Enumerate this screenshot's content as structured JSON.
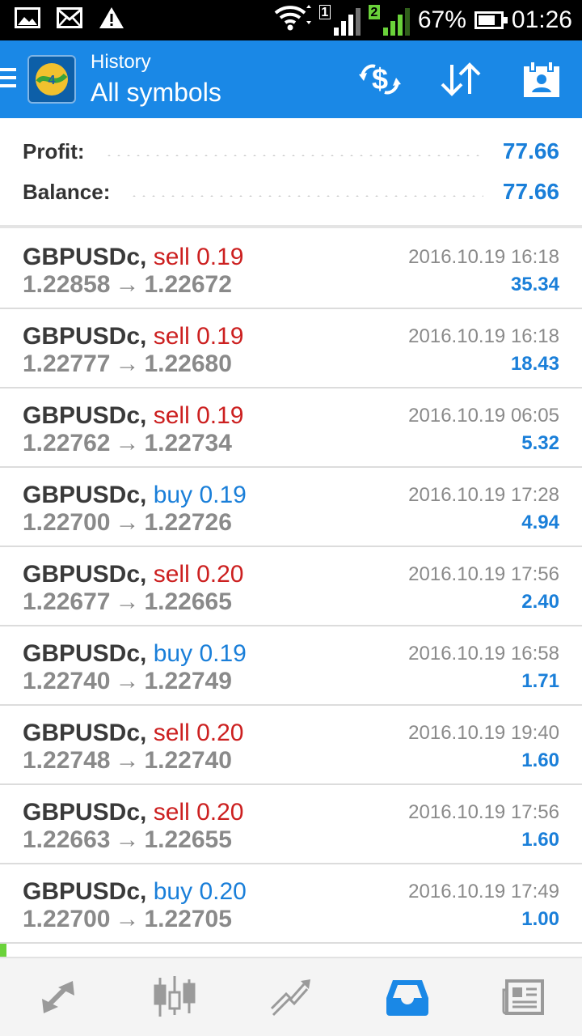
{
  "status_bar": {
    "icons_left": [
      "image-icon",
      "mail-icon",
      "warning-icon"
    ],
    "sim1_label": "1",
    "sim2_label": "2",
    "battery": "67%",
    "battery_level": 0.67,
    "time": "01:26"
  },
  "appbar": {
    "subtitle": "History",
    "title": "All symbols",
    "actions": [
      "currency-switch-icon",
      "sort-icon",
      "calendar-icon"
    ]
  },
  "summary": {
    "profit_label": "Profit:",
    "profit_value": "77.66",
    "balance_label": "Balance:",
    "balance_value": "77.66"
  },
  "deals": [
    {
      "symbol": "GBPUSDc,",
      "type": "sell",
      "volume": "0.19",
      "open": "1.22858",
      "close": "1.22672",
      "time": "2016.10.19 16:18",
      "profit": "35.34"
    },
    {
      "symbol": "GBPUSDc,",
      "type": "sell",
      "volume": "0.19",
      "open": "1.22777",
      "close": "1.22680",
      "time": "2016.10.19 16:18",
      "profit": "18.43"
    },
    {
      "symbol": "GBPUSDc,",
      "type": "sell",
      "volume": "0.19",
      "open": "1.22762",
      "close": "1.22734",
      "time": "2016.10.19 06:05",
      "profit": "5.32"
    },
    {
      "symbol": "GBPUSDc,",
      "type": "buy",
      "volume": "0.19",
      "open": "1.22700",
      "close": "1.22726",
      "time": "2016.10.19 17:28",
      "profit": "4.94"
    },
    {
      "symbol": "GBPUSDc,",
      "type": "sell",
      "volume": "0.20",
      "open": "1.22677",
      "close": "1.22665",
      "time": "2016.10.19 17:56",
      "profit": "2.40"
    },
    {
      "symbol": "GBPUSDc,",
      "type": "buy",
      "volume": "0.19",
      "open": "1.22740",
      "close": "1.22749",
      "time": "2016.10.19 16:58",
      "profit": "1.71"
    },
    {
      "symbol": "GBPUSDc,",
      "type": "sell",
      "volume": "0.20",
      "open": "1.22748",
      "close": "1.22740",
      "time": "2016.10.19 19:40",
      "profit": "1.60"
    },
    {
      "symbol": "GBPUSDc,",
      "type": "sell",
      "volume": "0.20",
      "open": "1.22663",
      "close": "1.22655",
      "time": "2016.10.19 17:56",
      "profit": "1.60"
    },
    {
      "symbol": "GBPUSDc,",
      "type": "buy",
      "volume": "0.20",
      "open": "1.22700",
      "close": "1.22705",
      "time": "2016.10.19 17:49",
      "profit": "1.00"
    }
  ],
  "arrow_glyph": "→",
  "bottom_nav": {
    "items": [
      "quotes-icon",
      "chart-icon",
      "trade-icon",
      "history-icon",
      "news-icon"
    ],
    "active": "history-icon",
    "active_color": "#1a88e6",
    "inactive_color": "#9a9a9a"
  },
  "colors": {
    "accent": "#1a88e6",
    "sell": "#cc2020",
    "buy": "#1a7fd9",
    "profit": "#1a7fd9"
  }
}
